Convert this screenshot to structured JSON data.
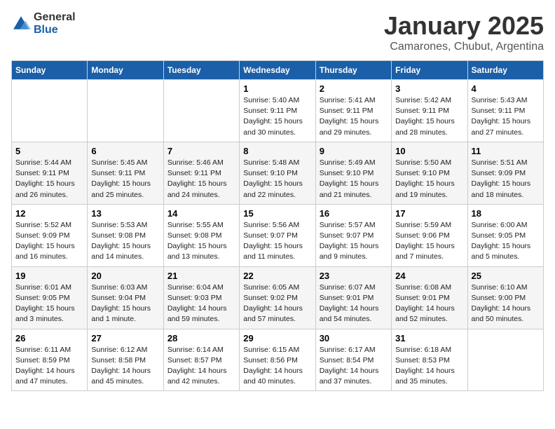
{
  "header": {
    "logo_general": "General",
    "logo_blue": "Blue",
    "month": "January 2025",
    "location": "Camarones, Chubut, Argentina"
  },
  "days_of_week": [
    "Sunday",
    "Monday",
    "Tuesday",
    "Wednesday",
    "Thursday",
    "Friday",
    "Saturday"
  ],
  "weeks": [
    [
      {
        "day": "",
        "info": ""
      },
      {
        "day": "",
        "info": ""
      },
      {
        "day": "",
        "info": ""
      },
      {
        "day": "1",
        "info": "Sunrise: 5:40 AM\nSunset: 9:11 PM\nDaylight: 15 hours and 30 minutes."
      },
      {
        "day": "2",
        "info": "Sunrise: 5:41 AM\nSunset: 9:11 PM\nDaylight: 15 hours and 29 minutes."
      },
      {
        "day": "3",
        "info": "Sunrise: 5:42 AM\nSunset: 9:11 PM\nDaylight: 15 hours and 28 minutes."
      },
      {
        "day": "4",
        "info": "Sunrise: 5:43 AM\nSunset: 9:11 PM\nDaylight: 15 hours and 27 minutes."
      }
    ],
    [
      {
        "day": "5",
        "info": "Sunrise: 5:44 AM\nSunset: 9:11 PM\nDaylight: 15 hours and 26 minutes."
      },
      {
        "day": "6",
        "info": "Sunrise: 5:45 AM\nSunset: 9:11 PM\nDaylight: 15 hours and 25 minutes."
      },
      {
        "day": "7",
        "info": "Sunrise: 5:46 AM\nSunset: 9:11 PM\nDaylight: 15 hours and 24 minutes."
      },
      {
        "day": "8",
        "info": "Sunrise: 5:48 AM\nSunset: 9:10 PM\nDaylight: 15 hours and 22 minutes."
      },
      {
        "day": "9",
        "info": "Sunrise: 5:49 AM\nSunset: 9:10 PM\nDaylight: 15 hours and 21 minutes."
      },
      {
        "day": "10",
        "info": "Sunrise: 5:50 AM\nSunset: 9:10 PM\nDaylight: 15 hours and 19 minutes."
      },
      {
        "day": "11",
        "info": "Sunrise: 5:51 AM\nSunset: 9:09 PM\nDaylight: 15 hours and 18 minutes."
      }
    ],
    [
      {
        "day": "12",
        "info": "Sunrise: 5:52 AM\nSunset: 9:09 PM\nDaylight: 15 hours and 16 minutes."
      },
      {
        "day": "13",
        "info": "Sunrise: 5:53 AM\nSunset: 9:08 PM\nDaylight: 15 hours and 14 minutes."
      },
      {
        "day": "14",
        "info": "Sunrise: 5:55 AM\nSunset: 9:08 PM\nDaylight: 15 hours and 13 minutes."
      },
      {
        "day": "15",
        "info": "Sunrise: 5:56 AM\nSunset: 9:07 PM\nDaylight: 15 hours and 11 minutes."
      },
      {
        "day": "16",
        "info": "Sunrise: 5:57 AM\nSunset: 9:07 PM\nDaylight: 15 hours and 9 minutes."
      },
      {
        "day": "17",
        "info": "Sunrise: 5:59 AM\nSunset: 9:06 PM\nDaylight: 15 hours and 7 minutes."
      },
      {
        "day": "18",
        "info": "Sunrise: 6:00 AM\nSunset: 9:05 PM\nDaylight: 15 hours and 5 minutes."
      }
    ],
    [
      {
        "day": "19",
        "info": "Sunrise: 6:01 AM\nSunset: 9:05 PM\nDaylight: 15 hours and 3 minutes."
      },
      {
        "day": "20",
        "info": "Sunrise: 6:03 AM\nSunset: 9:04 PM\nDaylight: 15 hours and 1 minute."
      },
      {
        "day": "21",
        "info": "Sunrise: 6:04 AM\nSunset: 9:03 PM\nDaylight: 14 hours and 59 minutes."
      },
      {
        "day": "22",
        "info": "Sunrise: 6:05 AM\nSunset: 9:02 PM\nDaylight: 14 hours and 57 minutes."
      },
      {
        "day": "23",
        "info": "Sunrise: 6:07 AM\nSunset: 9:01 PM\nDaylight: 14 hours and 54 minutes."
      },
      {
        "day": "24",
        "info": "Sunrise: 6:08 AM\nSunset: 9:01 PM\nDaylight: 14 hours and 52 minutes."
      },
      {
        "day": "25",
        "info": "Sunrise: 6:10 AM\nSunset: 9:00 PM\nDaylight: 14 hours and 50 minutes."
      }
    ],
    [
      {
        "day": "26",
        "info": "Sunrise: 6:11 AM\nSunset: 8:59 PM\nDaylight: 14 hours and 47 minutes."
      },
      {
        "day": "27",
        "info": "Sunrise: 6:12 AM\nSunset: 8:58 PM\nDaylight: 14 hours and 45 minutes."
      },
      {
        "day": "28",
        "info": "Sunrise: 6:14 AM\nSunset: 8:57 PM\nDaylight: 14 hours and 42 minutes."
      },
      {
        "day": "29",
        "info": "Sunrise: 6:15 AM\nSunset: 8:56 PM\nDaylight: 14 hours and 40 minutes."
      },
      {
        "day": "30",
        "info": "Sunrise: 6:17 AM\nSunset: 8:54 PM\nDaylight: 14 hours and 37 minutes."
      },
      {
        "day": "31",
        "info": "Sunrise: 6:18 AM\nSunset: 8:53 PM\nDaylight: 14 hours and 35 minutes."
      },
      {
        "day": "",
        "info": ""
      }
    ]
  ]
}
